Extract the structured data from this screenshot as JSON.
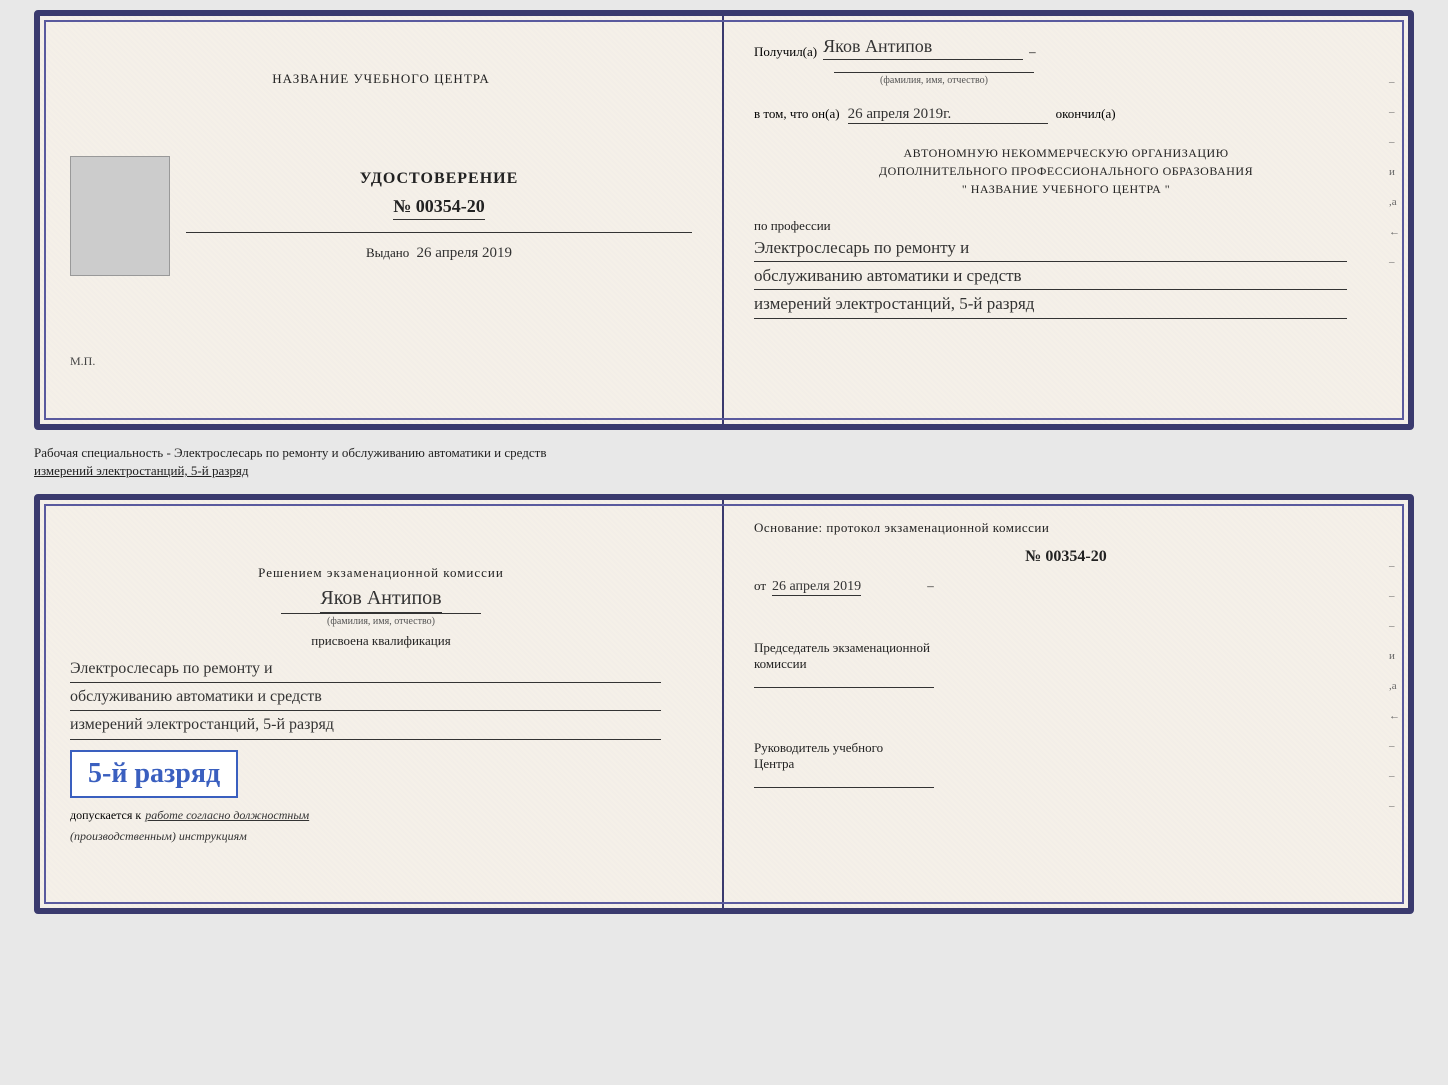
{
  "top_doc": {
    "left": {
      "center_title": "НАЗВАНИЕ УЧЕБНОГО ЦЕНТРА",
      "cert_label": "УДОСТОВЕРЕНИЕ",
      "cert_number": "№ 00354-20",
      "issued_prefix": "Выдано",
      "issued_date": "26 апреля 2019",
      "mp_label": "М.П."
    },
    "right": {
      "received_prefix": "Получил(а)",
      "recipient_name": "Яков Антипов",
      "fio_label": "(фамилия, имя, отчество)",
      "in_that_prefix": "в том, что он(а)",
      "date_handwritten": "26 апреля 2019г.",
      "finished_suffix": "окончил(а)",
      "org_line1": "АВТОНОМНУЮ НЕКОММЕРЧЕСКУЮ ОРГАНИЗАЦИЮ",
      "org_line2": "ДОПОЛНИТЕЛЬНОГО ПРОФЕССИОНАЛЬНОГО ОБРАЗОВАНИЯ",
      "org_line3": "\"  НАЗВАНИЕ УЧЕБНОГО ЦЕНТРА  \"",
      "profession_label": "по профессии",
      "profession_line1": "Электрослесарь по ремонту и",
      "profession_line2": "обслуживанию автоматики и средств",
      "profession_line3": "измерений электростанций, 5-й разряд"
    }
  },
  "separator": {
    "text": "Рабочая специальность - Электрослесарь по ремонту и обслуживанию автоматики и средств",
    "text2": "измерений электростанций, 5-й разряд"
  },
  "bottom_doc": {
    "left": {
      "decision_text": "Решением экзаменационной комиссии",
      "person_name": "Яков Антипов",
      "fio_label": "(фамилия, имя, отчество)",
      "assigned_label": "присвоена квалификация",
      "qual_line1": "Электрослесарь по ремонту и",
      "qual_line2": "обслуживанию автоматики и средств",
      "qual_line3": "измерений электростанций, 5-й разряд",
      "rank_text": "5-й разряд",
      "allowed_prefix": "допускается к",
      "allowed_handwritten": "работе согласно должностным",
      "allowed_handwritten2": "(производственным) инструкциям"
    },
    "right": {
      "basis_label": "Основание: протокол экзаменационной комиссии",
      "number_label": "№  00354-20",
      "date_prefix": "от",
      "date_value": "26 апреля 2019",
      "chairman_line1": "Председатель экзаменационной",
      "chairman_line2": "комиссии",
      "director_line1": "Руководитель учебного",
      "director_line2": "Центра"
    }
  },
  "margin_chars": {
    "top_right": [
      "–",
      "–",
      "–",
      "и",
      "а",
      "←",
      "–"
    ],
    "bottom_right": [
      "–",
      "–",
      "–",
      "и",
      "а",
      "←",
      "–",
      "–",
      "–"
    ]
  }
}
